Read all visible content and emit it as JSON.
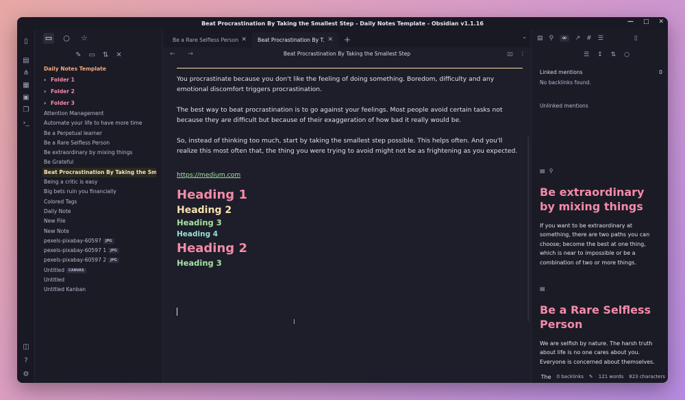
{
  "window": {
    "title": "Beat Procrastination By Taking the Smallest Step - Daily Notes Template - Obsidian v1.1.16",
    "minimize": "—",
    "maximize": "□",
    "close": "✕"
  },
  "ribbon": [
    "logo-icon",
    "file-icon",
    "graph-icon",
    "blocks-icon",
    "calendar-icon",
    "copy-icon",
    "terminal-icon",
    "vault-icon",
    "help-icon",
    "settings-icon"
  ],
  "left_tabs": [
    "folder-icon",
    "search-icon",
    "star-icon"
  ],
  "left_actions": [
    "new-note-icon",
    "new-folder-icon",
    "sort-icon",
    "collapse-icon"
  ],
  "tree": {
    "root": "Daily Notes Template",
    "folders": [
      "Folder 1",
      "Folder 2",
      "Folder 3"
    ],
    "files": [
      {
        "name": "Attention Management"
      },
      {
        "name": "Automate your life to have more time"
      },
      {
        "name": "Be a Perpetual learner"
      },
      {
        "name": "Be a Rare Selfless Person"
      },
      {
        "name": "Be extraordinary by mixing things"
      },
      {
        "name": "Be Grateful"
      },
      {
        "name": "Beat Procrastination By Taking the Smalle..."
      },
      {
        "name": "Being a critic is easy"
      },
      {
        "name": "Big bets ruin you financially"
      },
      {
        "name": "Colored Tags"
      },
      {
        "name": "Daily Note"
      },
      {
        "name": "New File"
      },
      {
        "name": "New Note"
      },
      {
        "name": "pexels-pixabay-60597",
        "badge": "JPG"
      },
      {
        "name": "pexels-pixabay-60597 1",
        "badge": "JPG"
      },
      {
        "name": "pexels-pixabay-60597 2",
        "badge": "JPG"
      },
      {
        "name": "Untitled",
        "badge": "CANVAS"
      },
      {
        "name": "Untitled"
      },
      {
        "name": "Untitled Kanban"
      }
    ]
  },
  "tabs": {
    "inactive": "Be a Rare Selfless Person",
    "active": "Beat Procrastination By T...",
    "close": "✕",
    "new": "+",
    "menu": "⌄"
  },
  "editor": {
    "header_title": "Beat Procrastination By Taking the Smallest Step",
    "nav": "← →",
    "paragraphs": [
      "You procrastinate because you don't like the feeling of doing something. Boredom, difficulty and any emotional discomfort triggers procrastination.",
      "The best way to beat procrastination is to go against your feelings. Most people avoid certain tasks not because they are difficult but because of their exaggeration of how bad it really would be.",
      "So, instead of thinking too much, start by taking the smallest step possible. This helps often. And you'll realize this most often that, the thing you were trying to avoid might not be as frightening as you expected."
    ],
    "link": "https://medium.com",
    "headings": {
      "h1": "Heading 1",
      "h2": "Heading 2",
      "h3": "Heading 3",
      "h4": "Heading 4",
      "h2b": "Heading 2",
      "h3b": "Heading 3"
    }
  },
  "right_tabs": [
    "file-icon",
    "pin-icon",
    "link-icon",
    "hashtag-icon",
    "list-icon"
  ],
  "right_tools": [
    "list-icon",
    "expand-icon",
    "sort-icon",
    "search-icon"
  ],
  "backlinks": {
    "linked_label": "Linked mentions",
    "linked_count": "0",
    "none": "No backlinks found.",
    "unlinked_label": "Unlinked mentions"
  },
  "previews": [
    {
      "title": "Be extraordinary by mixing things",
      "text": "If you want to be extraordinary at something, there are two paths you can choose; become the best at one thing, which is near to impossible or be a combination of two or more things."
    },
    {
      "title": "Be a Rare Selfless Person",
      "text": "We are selfish by nature. The harsh truth about life is no one cares about you. Everyone is concerned about themselves."
    }
  ],
  "status": {
    "cut_text": "The",
    "backlinks": "0 backlinks",
    "words": "121 words",
    "chars": "823 characters"
  }
}
